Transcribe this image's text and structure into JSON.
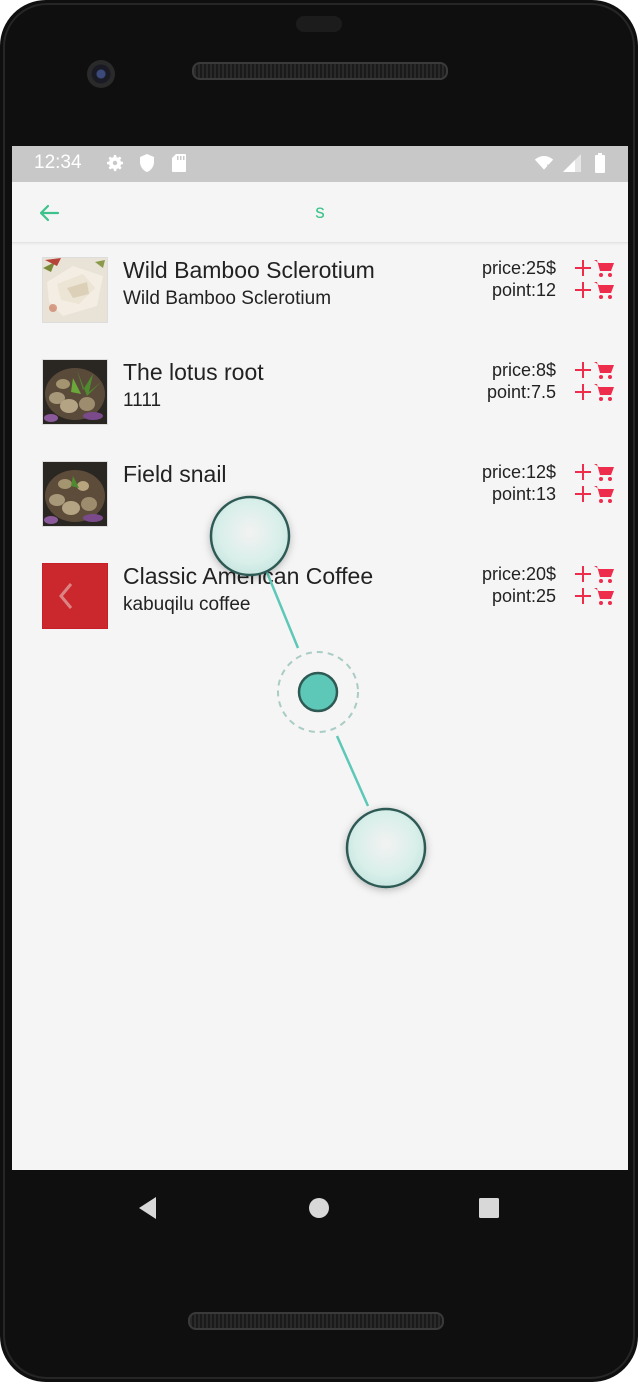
{
  "status": {
    "time": "12:34",
    "left_icons": [
      "gear-icon",
      "shield-icon",
      "sd-card-icon"
    ],
    "right_icons": [
      "wifi-icon",
      "signal-icon",
      "battery-icon"
    ]
  },
  "appbar": {
    "title": "s",
    "back_icon": "back-arrow-icon"
  },
  "items": [
    {
      "name": "Wild Bamboo Sclerotium",
      "desc": "Wild Bamboo Sclerotium",
      "price": "price:25$",
      "point": "point:12",
      "thumb": "bamboo-dish"
    },
    {
      "name": "The lotus root",
      "desc": "1111",
      "price": "price:8$",
      "point": "point:7.5",
      "thumb": "hotpot-dish"
    },
    {
      "name": "Field snail",
      "desc": "",
      "price": "price:12$",
      "point": "point:13",
      "thumb": "hotpot-dish"
    },
    {
      "name": "Classic American Coffee",
      "desc": "kabuqilu coffee",
      "price": "price:20$",
      "point": "point:25",
      "thumb": "red-arrow-tile"
    }
  ],
  "colors": {
    "accent": "#3ec28b",
    "cart": "#ee2c4c",
    "gesture": "#5ec8b8"
  },
  "navbar": [
    "back-triangle-icon",
    "home-circle-icon",
    "recents-square-icon"
  ]
}
